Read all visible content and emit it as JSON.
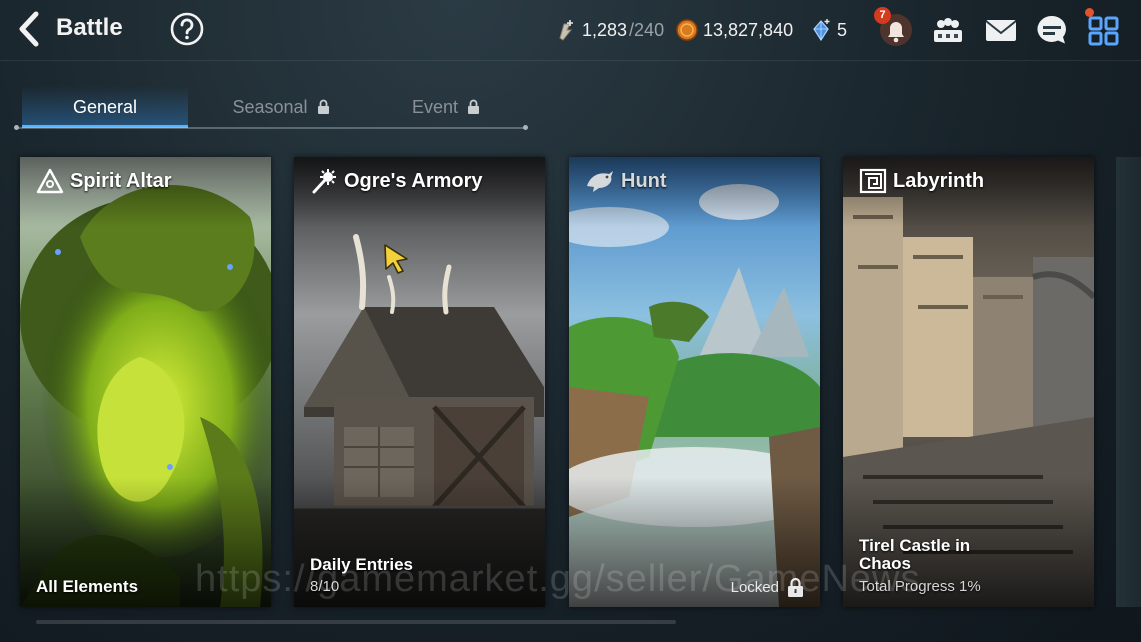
{
  "header": {
    "title": "Battle",
    "stamina": {
      "value": "1,283",
      "max": "/240"
    },
    "gold": "13,827,840",
    "crystals": "5",
    "notification_count": "7"
  },
  "tabs": [
    {
      "label": "General",
      "active": true,
      "locked": false
    },
    {
      "label": "Seasonal",
      "active": false,
      "locked": true
    },
    {
      "label": "Event",
      "active": false,
      "locked": true
    }
  ],
  "cards": [
    {
      "title": "Spirit Altar",
      "line1": "All Elements",
      "line2": "",
      "status": ""
    },
    {
      "title": "Ogre's Armory",
      "line1": "Daily Entries",
      "line2": "8/10",
      "status": ""
    },
    {
      "title": "Hunt",
      "line1": "",
      "line2": "",
      "status": "Locked"
    },
    {
      "title": "Labyrinth",
      "line1": "Tirel Castle in",
      "line1b": "Chaos",
      "line2": "Total Progress 1%",
      "status": ""
    }
  ],
  "watermark": "https://gamemarket.gg/seller/GameNews",
  "colors": {
    "accent": "#56b4ff",
    "badge": "#d43a1e"
  },
  "icons": [
    "back-arrow-icon",
    "help-icon",
    "stamina-icon",
    "gold-coin-icon",
    "crystal-icon",
    "bell-icon",
    "team-icon",
    "mail-icon",
    "chat-icon",
    "menu-grid-icon",
    "lock-icon"
  ]
}
